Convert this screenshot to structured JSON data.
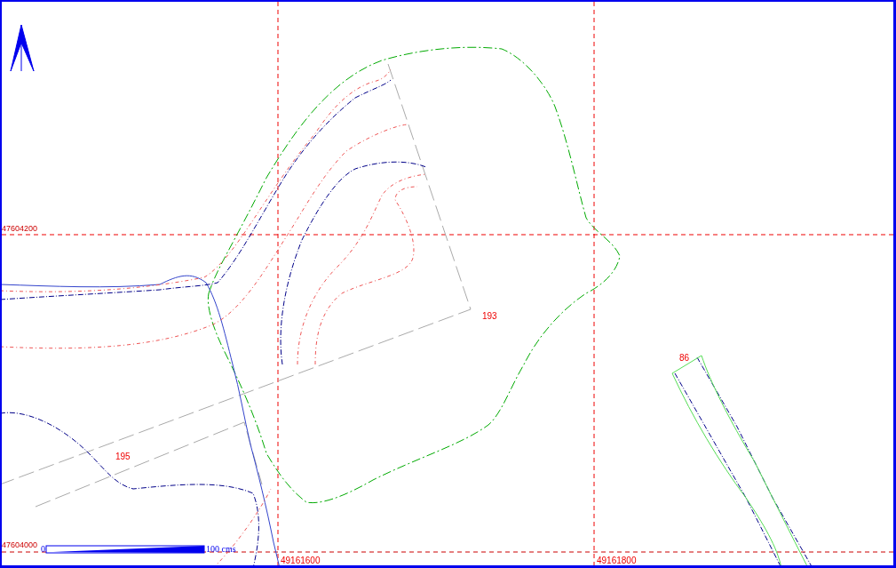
{
  "northing_labels": [
    "47604200",
    "47604000"
  ],
  "easting_labels": [
    "49161600",
    "49161800"
  ],
  "parcel_labels": [
    "193",
    "195",
    "86"
  ],
  "scale_bar": {
    "start": "0",
    "end": "100 cms"
  }
}
